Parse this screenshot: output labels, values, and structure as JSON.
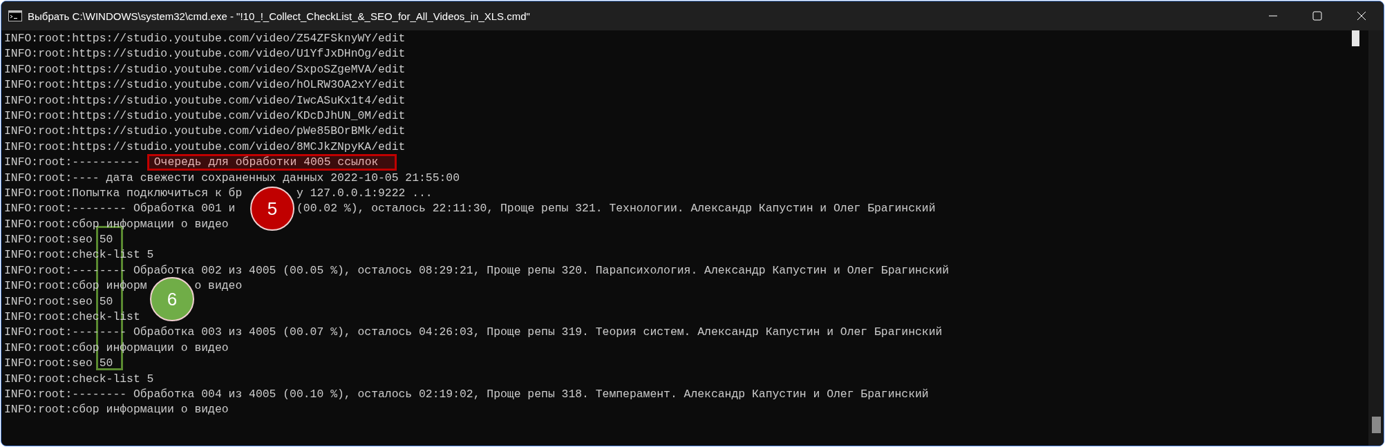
{
  "window": {
    "title": "Выбрать C:\\WINDOWS\\system32\\cmd.exe - \"!10_!_Collect_CheckList_&_SEO_for_All_Videos_in_XLS.cmd\""
  },
  "lines": [
    {
      "text": "INFO:root:https://studio.youtube.com/video/Z54ZFSknyWY/edit"
    },
    {
      "text": "INFO:root:https://studio.youtube.com/video/U1YfJxDHnOg/edit"
    },
    {
      "text": "INFO:root:https://studio.youtube.com/video/SxpoSZgeMVA/edit"
    },
    {
      "text": "INFO:root:https://studio.youtube.com/video/hOLRW3OA2xY/edit"
    },
    {
      "text": "INFO:root:https://studio.youtube.com/video/IwcASuKx1t4/edit"
    },
    {
      "text": "INFO:root:https://studio.youtube.com/video/KDcDJhUN_0M/edit"
    },
    {
      "text": "INFO:root:https://studio.youtube.com/video/pWe85BOrBMk/edit"
    },
    {
      "text": "INFO:root:https://studio.youtube.com/video/8MCJkZNpyKA/edit"
    },
    {
      "text": "INFO:root:----------",
      "highlight": "Очередь для обработки 4005 ссылок"
    },
    {
      "text": "INFO:root:---- дата свежести сохраненных данных 2022-10-05 21:55:00"
    },
    {
      "parts": [
        "INFO:root:Попытка подключиться к бр",
        "у 127.0.0.1:9222 ..."
      ]
    },
    {
      "parts": [
        "INFO:root:-------- Обработка 001 и",
        "(00.02 %), осталось 22:11:30, Проще репы 321. Технологии. Александр Капустин и Олег Брагинский"
      ]
    },
    {
      "text": "INFO:root:сбор информации о видео"
    },
    {
      "text": "INFO:root:seo 50"
    },
    {
      "text": "INFO:root:check-list 5"
    },
    {
      "text": "INFO:root:-------- Обработка 002 из 4005 (00.05 %), осталось 08:29:21, Проще репы 320. Парапсихология. Александр Капустин и Олег Брагинский"
    },
    {
      "parts": [
        "INFO:root:сбор информ",
        "о видео"
      ]
    },
    {
      "text": "INFO:root:seo 50"
    },
    {
      "text": "INFO:root:check-list"
    },
    {
      "text": "INFO:root:-------- Обработка 003 из 4005 (00.07 %), осталось 04:26:03, Проще репы 319. Теория систем. Александр Капустин и Олег Брагинский"
    },
    {
      "text": "INFO:root:сбор информации о видео"
    },
    {
      "text": "INFO:root:seo 50"
    },
    {
      "text": "INFO:root:check-list 5"
    },
    {
      "text": "INFO:root:-------- Обработка 004 из 4005 (00.10 %), осталось 02:19:02, Проще репы 318. Темперамент. Александр Капустин и Олег Брагинский"
    },
    {
      "text": "INFO:root:сбор информации о видео"
    }
  ],
  "callouts": [
    {
      "label": "5",
      "color": "#c00000"
    },
    {
      "label": "6",
      "color": "#70ad47"
    }
  ]
}
